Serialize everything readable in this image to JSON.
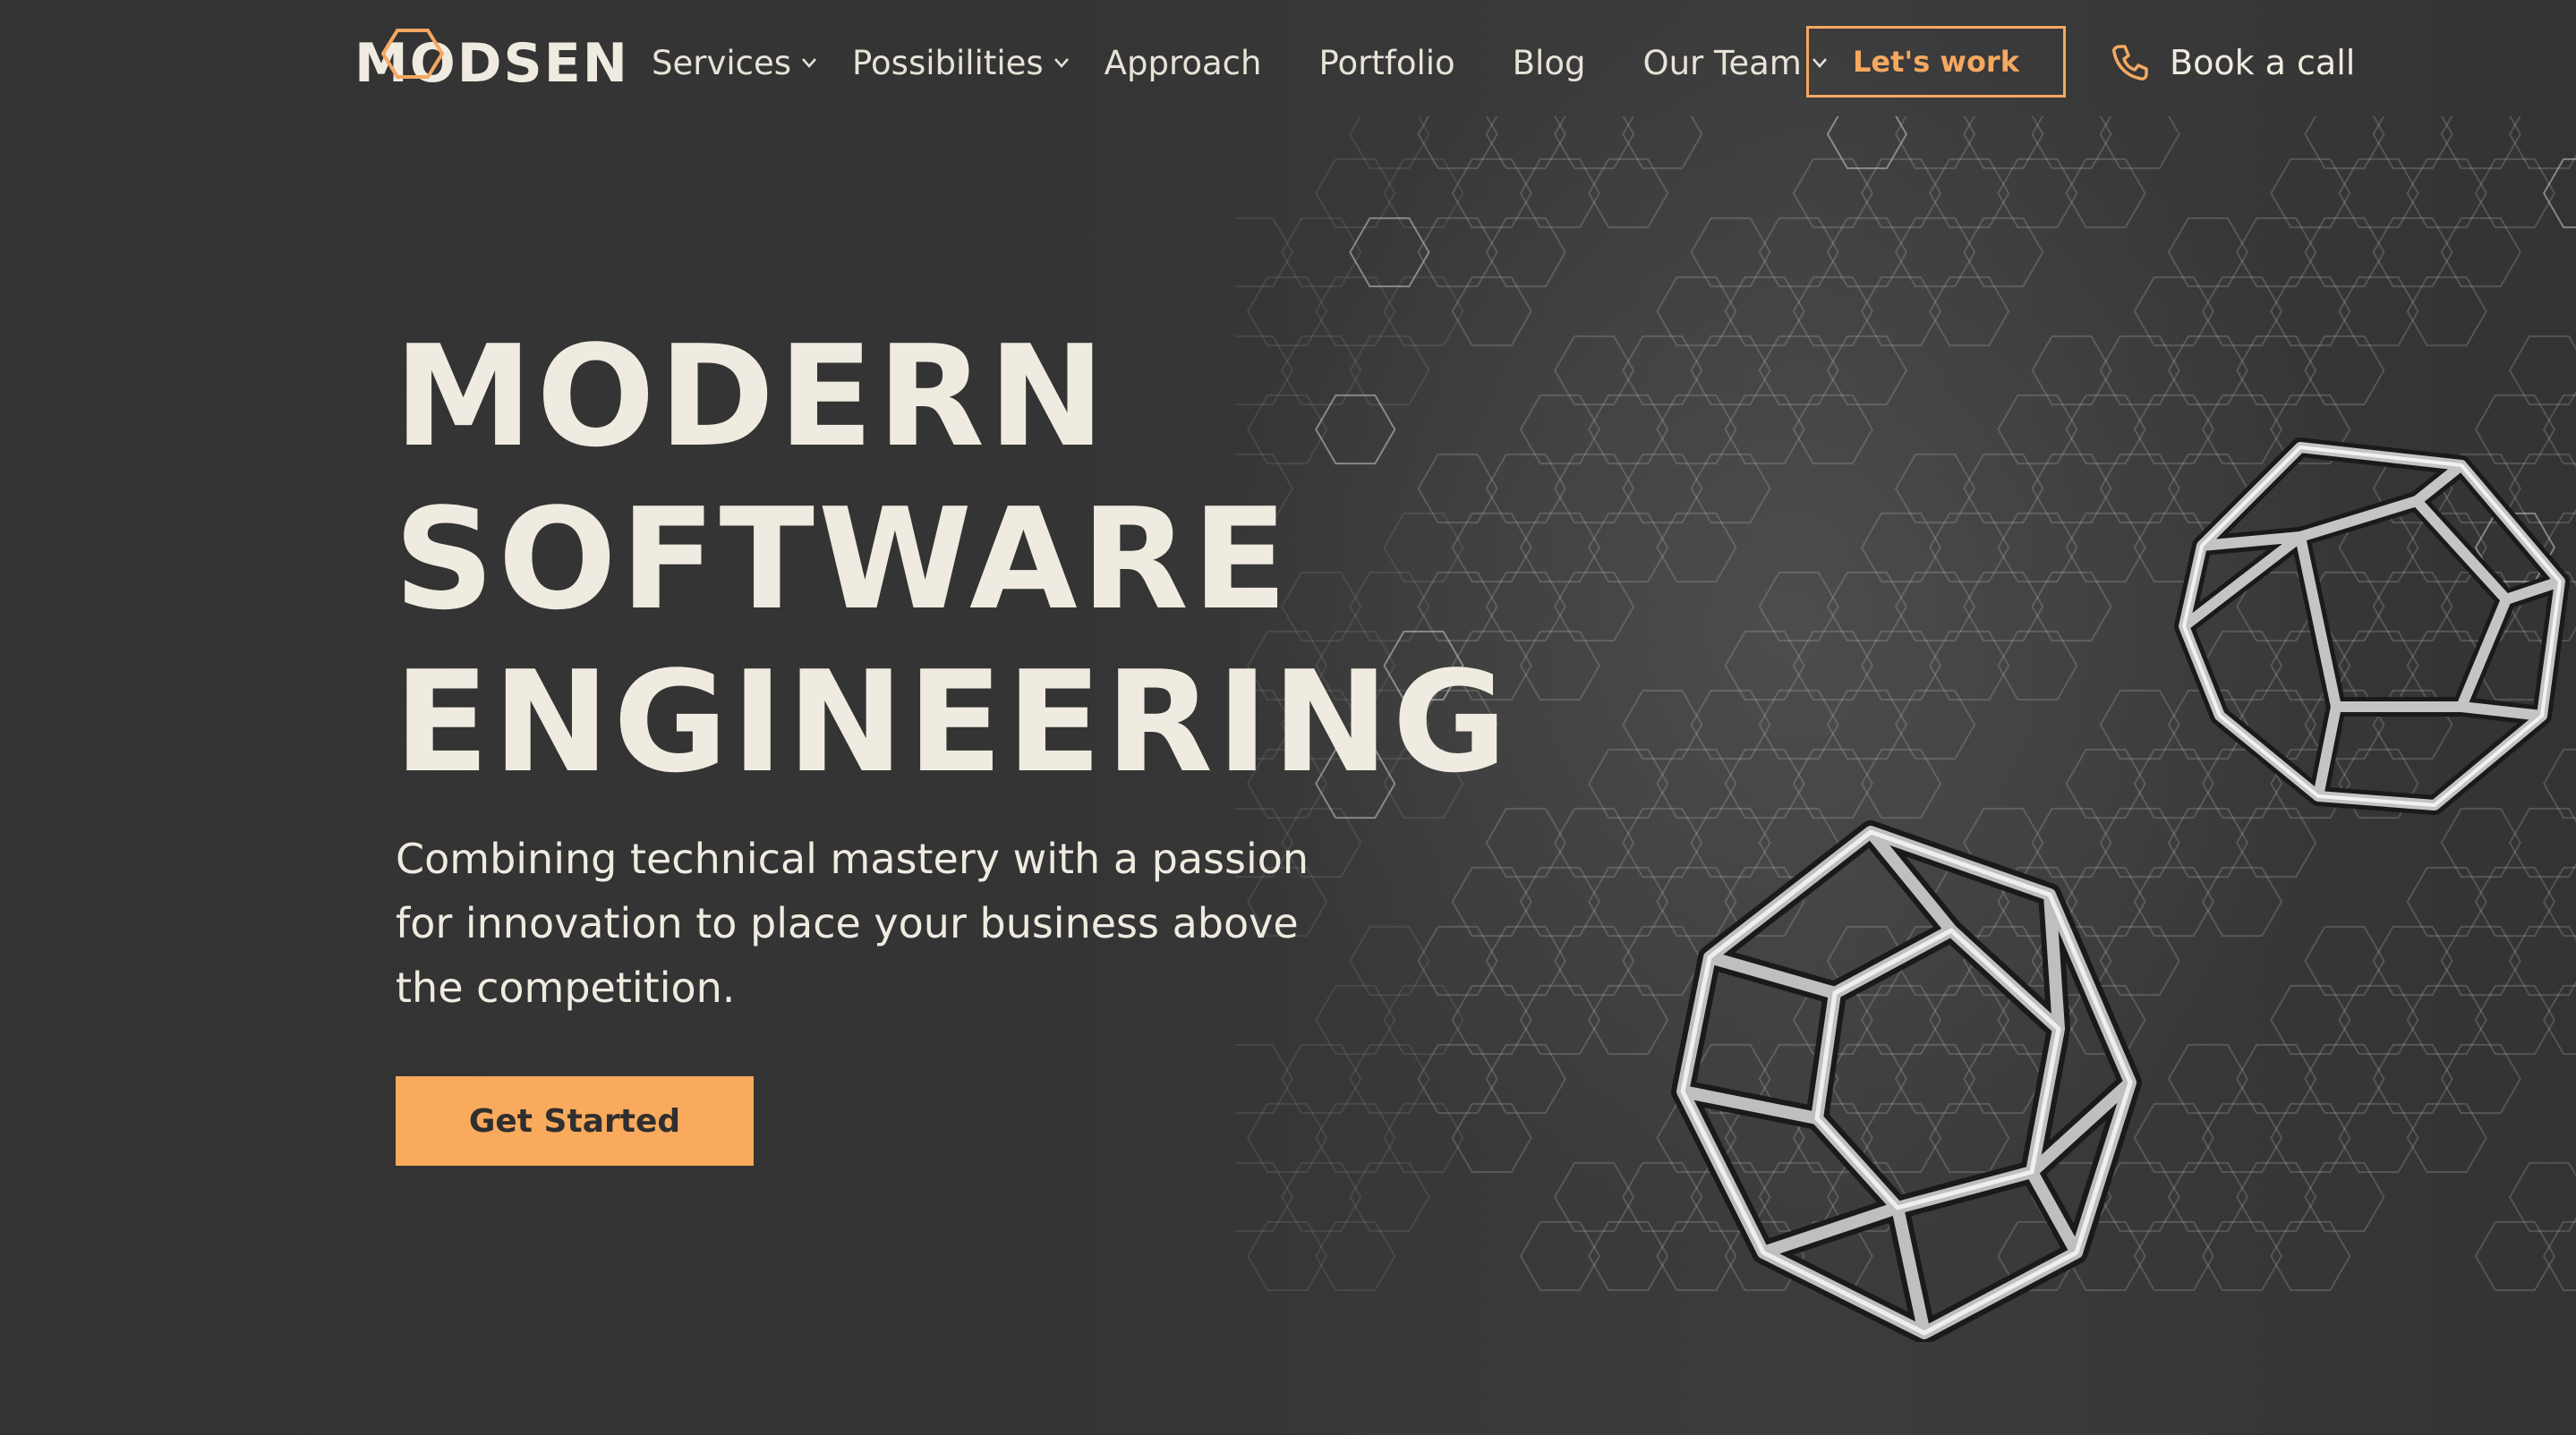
{
  "header": {
    "logo_text": "MODSEN",
    "nav": [
      {
        "label": "Services",
        "dropdown": true
      },
      {
        "label": "Possibilities",
        "dropdown": true
      },
      {
        "label": "Approach",
        "dropdown": false
      },
      {
        "label": "Portfolio",
        "dropdown": false
      },
      {
        "label": "Blog",
        "dropdown": false
      },
      {
        "label": "Our Team",
        "dropdown": true
      }
    ],
    "cta_label": "Let's work",
    "book_call_label": "Book a call"
  },
  "hero": {
    "title_lines": [
      "MODERN",
      "SOFTWARE",
      "ENGINEERING"
    ],
    "subtitle_lines": [
      "Combining technical mastery with a passion",
      "for innovation to place your business above",
      "the competition."
    ],
    "button_label": "Get Started"
  },
  "icons": {
    "logo": "hexagon-logo-icon",
    "phone": "phone-icon",
    "dropdown": "chevron-down-icon"
  },
  "colors": {
    "background": "#333333",
    "accent": "#f9aa5c",
    "text": "#f0ebe0"
  }
}
